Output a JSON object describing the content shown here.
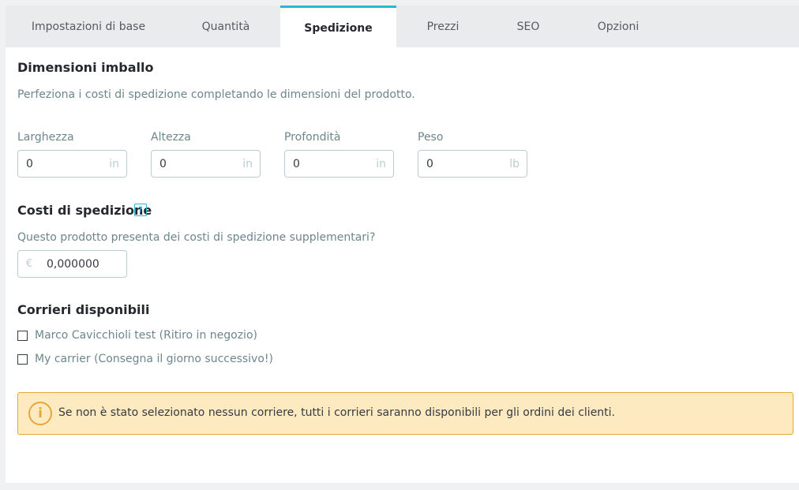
{
  "tabs": [
    {
      "label": "Impostazioni di base"
    },
    {
      "label": "Quantità"
    },
    {
      "label": "Spedizione",
      "active": true
    },
    {
      "label": "Prezzi"
    },
    {
      "label": "SEO"
    },
    {
      "label": "Opzioni"
    }
  ],
  "package": {
    "title": "Dimensioni imballo",
    "description": "Perfeziona i costi di spedizione completando le dimensioni del prodotto.",
    "fields": [
      {
        "label": "Larghezza",
        "value": "0",
        "unit": "in"
      },
      {
        "label": "Altezza",
        "value": "0",
        "unit": "in"
      },
      {
        "label": "Profondità",
        "value": "0",
        "unit": "in"
      },
      {
        "label": "Peso",
        "value": "0",
        "unit": "lb"
      }
    ]
  },
  "shipping_costs": {
    "title": "Costi di spedizione",
    "help_icon": "help-icon",
    "question": "Questo prodotto presenta dei costi di spedizione supplementari?",
    "currency": "€",
    "value": "0,000000"
  },
  "carriers": {
    "title": "Corrieri disponibili",
    "items": [
      {
        "label": "Marco Cavicchioli test (Ritiro in negozio)",
        "checked": false
      },
      {
        "label": "My carrier (Consegna il giorno successivo!)",
        "checked": false
      }
    ]
  },
  "alert": {
    "icon": "info-icon",
    "icon_glyph": "i",
    "text": "Se non è stato selezionato nessun corriere, tutti i corrieri saranno disponibili per gli ordini dei clienti."
  },
  "colors": {
    "accent": "#25b9d7",
    "warning_bg": "#fdeac0",
    "warning_border": "#e5a837"
  }
}
